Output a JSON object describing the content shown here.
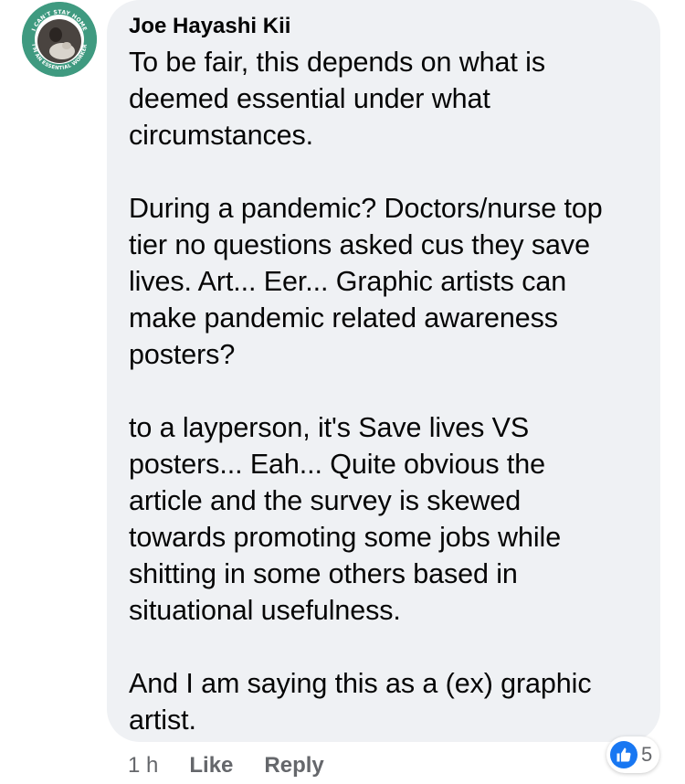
{
  "comment": {
    "author": "Joe Hayashi Kii",
    "avatar_badge_text_top": "I CAN'T STAY HOME",
    "avatar_badge_text_bottom": "I'M AN ESSENTIAL WORKER",
    "paragraphs": [
      {
        "lines": [
          "To be fair, this depends on what is",
          "deemed essential under what",
          "circumstances."
        ]
      },
      {
        "lines": [
          "During a pandemic? Doctors/nurse top",
          "tier no questions asked cus they save",
          "lives. Art... Eer... Graphic artists can",
          "make pandemic related awareness",
          "posters?"
        ]
      },
      {
        "lines": [
          "to a layperson, it's Save lives VS",
          "posters... Eah... Quite obvious the",
          "article and the survey is skewed",
          "towards promoting some jobs while",
          "shitting in some others based in",
          "situational usefulness."
        ]
      },
      {
        "lines": [
          "And I am saying this as a (ex) graphic",
          "artist."
        ]
      }
    ]
  },
  "actions": {
    "time": "1 h",
    "like_label": "Like",
    "reply_label": "Reply"
  },
  "reactions": {
    "icon": "like-icon",
    "count": "5",
    "color": "#1877f2"
  },
  "colors": {
    "bubble": "#eff1f4",
    "secondary_text": "#65676b",
    "avatar_ring": "#3f9a80"
  }
}
